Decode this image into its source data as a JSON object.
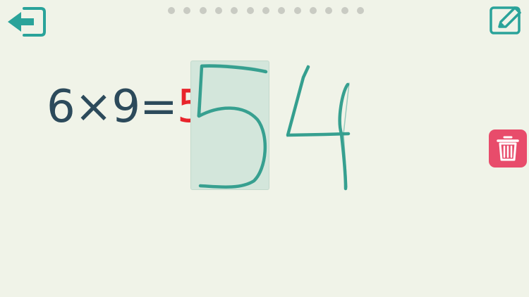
{
  "header": {
    "back_icon": "back-arrow-icon",
    "progress_dot_count": 13,
    "edit_icon": "pencil-edit-icon"
  },
  "problem": {
    "operand_a": "6",
    "operator": "×",
    "operand_b": "9",
    "equals": "=",
    "entered_digit": "5"
  },
  "handwriting": {
    "strokes_written": [
      "5",
      "4"
    ],
    "ink_color": "#2e9c8c"
  },
  "tools": {
    "trash_icon": "trash-can-icon"
  },
  "colors": {
    "accent": "#2aa39a",
    "equation_text": "#2c4a5b",
    "answer_text": "#e8242b",
    "trash_bg": "#e84c6b",
    "highlight": "#d3e6db",
    "background": "#f0f3e8"
  }
}
